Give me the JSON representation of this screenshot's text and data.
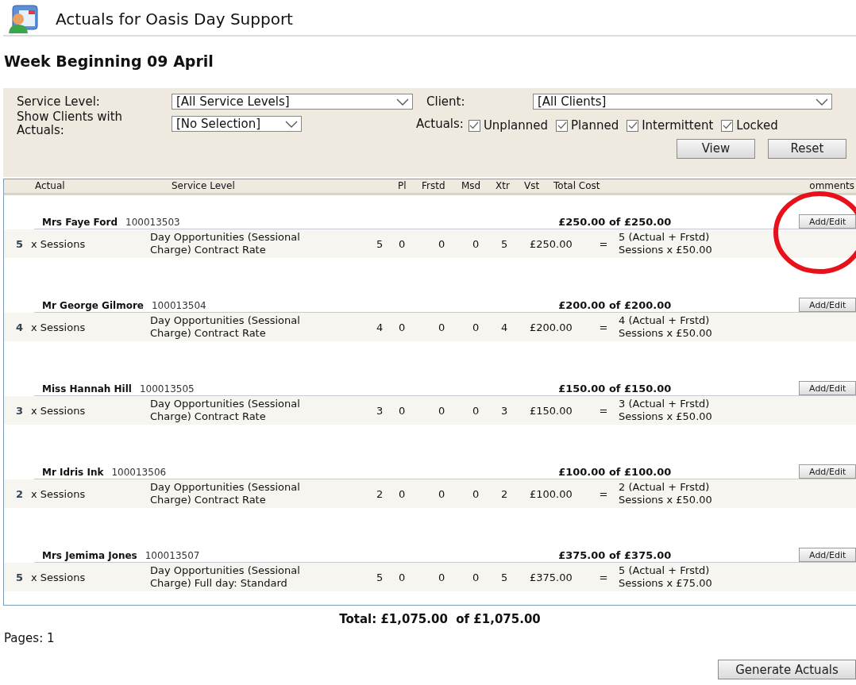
{
  "title": "Actuals for Oasis Day Support",
  "week_heading": "Week Beginning 09 April",
  "filters": {
    "service_level": {
      "label": "Service Level:",
      "value": "[All Service Levels]"
    },
    "client": {
      "label": "Client:",
      "value": "[All Clients]"
    },
    "show_clients": {
      "label": "Show Clients with Actuals:",
      "value": "[No Selection]"
    },
    "actuals": {
      "label": "Actuals:",
      "options": [
        {
          "label": "Unplanned",
          "checked": true
        },
        {
          "label": "Planned",
          "checked": true
        },
        {
          "label": "Intermittent",
          "checked": true
        },
        {
          "label": "Locked",
          "checked": true
        }
      ]
    },
    "buttons": [
      "View",
      "Reset"
    ]
  },
  "table": {
    "columns": [
      "Actual",
      "Service Level",
      "Pl",
      "Frstd",
      "Msd",
      "Xtr",
      "Vst",
      "Total Cost",
      "omments"
    ],
    "clients": [
      {
        "name": "Mrs Faye Ford",
        "id": "100013503",
        "total": "£250.00 of £250.00",
        "button": "Add/Edit",
        "lines": [
          {
            "qty": "5",
            "unit": "x Sessions",
            "service_level": "Day Opportunities (Sessional Charge) Contract Rate",
            "pl": "5",
            "frstd": "0",
            "msd": "0",
            "xtr": "0",
            "vst": "5",
            "cost": "£250.00",
            "equals": "=",
            "formula": "5 (Actual + Frstd) Sessions x £50.00"
          }
        ]
      },
      {
        "name": "Mr George Gilmore",
        "id": "100013504",
        "total": "£200.00 of £200.00",
        "button": "Add/Edit",
        "lines": [
          {
            "qty": "4",
            "unit": "x Sessions",
            "service_level": "Day Opportunities (Sessional Charge) Contract Rate",
            "pl": "4",
            "frstd": "0",
            "msd": "0",
            "xtr": "0",
            "vst": "4",
            "cost": "£200.00",
            "equals": "=",
            "formula": "4 (Actual + Frstd) Sessions x £50.00"
          }
        ]
      },
      {
        "name": "Miss Hannah Hill",
        "id": "100013505",
        "total": "£150.00 of £150.00",
        "button": "Add/Edit",
        "lines": [
          {
            "qty": "3",
            "unit": "x Sessions",
            "service_level": "Day Opportunities (Sessional Charge) Contract Rate",
            "pl": "3",
            "frstd": "0",
            "msd": "0",
            "xtr": "0",
            "vst": "3",
            "cost": "£150.00",
            "equals": "=",
            "formula": "3 (Actual + Frstd) Sessions x £50.00"
          }
        ]
      },
      {
        "name": "Mr Idris Ink",
        "id": "100013506",
        "total": "£100.00 of £100.00",
        "button": "Add/Edit",
        "lines": [
          {
            "qty": "2",
            "unit": "x Sessions",
            "service_level": "Day Opportunities (Sessional Charge) Contract Rate",
            "pl": "2",
            "frstd": "0",
            "msd": "0",
            "xtr": "0",
            "vst": "2",
            "cost": "£100.00",
            "equals": "=",
            "formula": "2 (Actual + Frstd) Sessions x £50.00"
          }
        ]
      },
      {
        "name": "Mrs Jemima Jones",
        "id": "100013507",
        "total": "£375.00 of £375.00",
        "button": "Add/Edit",
        "lines": [
          {
            "qty": "5",
            "unit": "x Sessions",
            "service_level": "Day Opportunities (Sessional Charge) Full day: Standard",
            "pl": "5",
            "frstd": "0",
            "msd": "0",
            "xtr": "0",
            "vst": "5",
            "cost": "£375.00",
            "equals": "=",
            "formula": "5 (Actual + Frstd) Sessions x £75.00"
          }
        ]
      }
    ]
  },
  "grand_total": "Total: £1,075.00  of £1,075.00",
  "pages": "Pages: 1",
  "generate_button": "Generate Actuals"
}
